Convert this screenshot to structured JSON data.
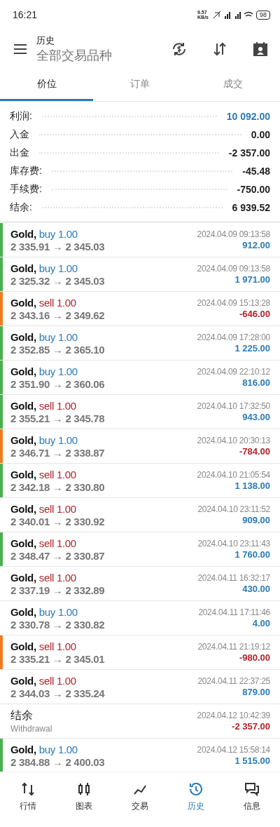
{
  "status_bar": {
    "time": "16:21",
    "speed": "9.57",
    "speed_unit": "KB/s",
    "battery": "98"
  },
  "header": {
    "title": "历史",
    "subtitle": "全部交易品种"
  },
  "tabs": [
    {
      "label": "价位",
      "selected": true
    },
    {
      "label": "订单",
      "selected": false
    },
    {
      "label": "成交",
      "selected": false
    }
  ],
  "summary": [
    {
      "label": "利润:",
      "value": "10 092.00",
      "highlight": true
    },
    {
      "label": "入金",
      "value": "0.00",
      "highlight": false
    },
    {
      "label": "出金",
      "value": "-2 357.00",
      "highlight": false
    },
    {
      "label": "库存费:",
      "value": "-45.48",
      "highlight": false
    },
    {
      "label": "手续费:",
      "value": "-750.00",
      "highlight": false
    },
    {
      "label": "结余:",
      "value": "6 939.52",
      "highlight": false
    }
  ],
  "deals": [
    {
      "kind": "trade",
      "symbol": "Gold,",
      "side": "buy",
      "volume": "1.00",
      "prices": "2 335.91 → 2 345.03",
      "time": "2024.04.09 09:13:58",
      "profit": "912.00",
      "loss": false,
      "color": "#4caf50"
    },
    {
      "kind": "trade",
      "symbol": "Gold,",
      "side": "buy",
      "volume": "1.00",
      "prices": "2 325.32 → 2 345.03",
      "time": "2024.04.09 09:13:58",
      "profit": "1 971.00",
      "loss": false,
      "color": "#4caf50"
    },
    {
      "kind": "trade",
      "symbol": "Gold,",
      "side": "sell",
      "volume": "1.00",
      "prices": "2 343.16 → 2 349.62",
      "time": "2024.04.09 15:13:28",
      "profit": "-646.00",
      "loss": true,
      "color": "#f07c22"
    },
    {
      "kind": "trade",
      "symbol": "Gold,",
      "side": "buy",
      "volume": "1.00",
      "prices": "2 352.85 → 2 365.10",
      "time": "2024.04.09 17:28:00",
      "profit": "1 225.00",
      "loss": false,
      "color": "#4caf50"
    },
    {
      "kind": "trade",
      "symbol": "Gold,",
      "side": "buy",
      "volume": "1.00",
      "prices": "2 351.90 → 2 360.06",
      "time": "2024.04.09 22:10:12",
      "profit": "816.00",
      "loss": false,
      "color": "#4caf50"
    },
    {
      "kind": "trade",
      "symbol": "Gold,",
      "side": "sell",
      "volume": "1.00",
      "prices": "2 355.21 → 2 345.78",
      "time": "2024.04.10 17:32:50",
      "profit": "943.00",
      "loss": false,
      "color": "#4caf50"
    },
    {
      "kind": "trade",
      "symbol": "Gold,",
      "side": "buy",
      "volume": "1.00",
      "prices": "2 346.71 → 2 338.87",
      "time": "2024.04.10 20:30:13",
      "profit": "-784.00",
      "loss": true,
      "color": "#f07c22"
    },
    {
      "kind": "trade",
      "symbol": "Gold,",
      "side": "sell",
      "volume": "1.00",
      "prices": "2 342.18 → 2 330.80",
      "time": "2024.04.10 21:05:54",
      "profit": "1 138.00",
      "loss": false,
      "color": "#4caf50"
    },
    {
      "kind": "trade",
      "symbol": "Gold,",
      "side": "sell",
      "volume": "1.00",
      "prices": "2 340.01 → 2 330.92",
      "time": "2024.04.10 23:11:52",
      "profit": "909.00",
      "loss": false
    },
    {
      "kind": "trade",
      "symbol": "Gold,",
      "side": "sell",
      "volume": "1.00",
      "prices": "2 348.47 → 2 330.87",
      "time": "2024.04.10 23:11:43",
      "profit": "1 760.00",
      "loss": false,
      "color": "#4caf50"
    },
    {
      "kind": "trade",
      "symbol": "Gold,",
      "side": "sell",
      "volume": "1.00",
      "prices": "2 337.19 → 2 332.89",
      "time": "2024.04.11 16:32:17",
      "profit": "430.00",
      "loss": false
    },
    {
      "kind": "trade",
      "symbol": "Gold,",
      "side": "buy",
      "volume": "1.00",
      "prices": "2 330.78 → 2 330.82",
      "time": "2024.04.11 17:11:46",
      "profit": "4.00",
      "loss": false
    },
    {
      "kind": "trade",
      "symbol": "Gold,",
      "side": "sell",
      "volume": "1.00",
      "prices": "2 335.21 → 2 345.01",
      "time": "2024.04.11 21:19:12",
      "profit": "-980.00",
      "loss": true,
      "color": "#f07c22"
    },
    {
      "kind": "trade",
      "symbol": "Gold,",
      "side": "sell",
      "volume": "1.00",
      "prices": "2 344.03 → 2 335.24",
      "time": "2024.04.11 22:37:25",
      "profit": "879.00",
      "loss": false
    },
    {
      "kind": "balance",
      "title": "结余",
      "comment": "Withdrawal",
      "time": "2024.04.12 10:42:39",
      "profit": "-2 357.00",
      "loss": true
    },
    {
      "kind": "trade",
      "symbol": "Gold,",
      "side": "buy",
      "volume": "1.00",
      "prices": "2 384.88 → 2 400.03",
      "time": "2024.04.12 15:58:14",
      "profit": "1 515.00",
      "loss": false,
      "color": "#4caf50"
    }
  ],
  "nav": [
    {
      "kind": "quotes",
      "label": "行情",
      "selected": false
    },
    {
      "kind": "chart",
      "label": "图表",
      "selected": false
    },
    {
      "kind": "trade",
      "label": "交易",
      "selected": false
    },
    {
      "kind": "history",
      "label": "历史",
      "selected": true
    },
    {
      "kind": "messages",
      "label": "信息",
      "selected": false
    }
  ]
}
